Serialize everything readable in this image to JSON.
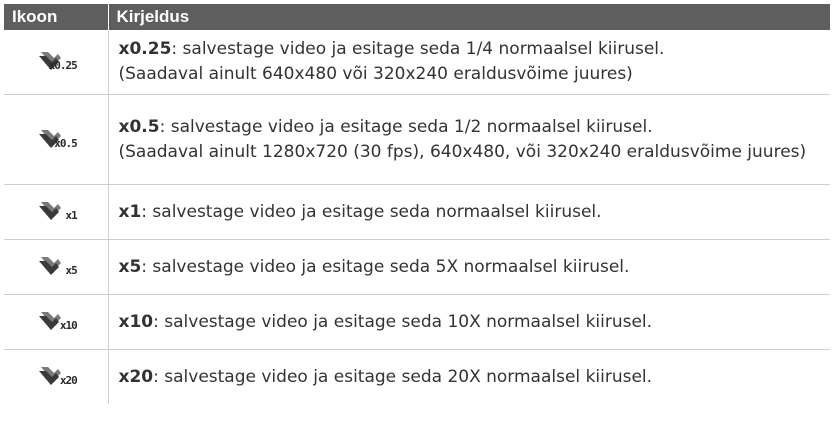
{
  "header": {
    "col_icon": "Ikoon",
    "col_desc": "Kirjeldus"
  },
  "rows": [
    {
      "icon": "slow-motion-x0.25-icon",
      "icon_label": "x0.25",
      "mode": "x0.25",
      "text": ": salvestage video ja esitage seda 1/4 normaalsel kiirusel.",
      "note": "(Saadaval ainult 640x480 või 320x240 eraldusvõime juures)"
    },
    {
      "icon": "slow-motion-x0.5-icon",
      "icon_label": "x0.5",
      "mode": "x0.5",
      "text": ": salvestage video ja esitage seda 1/2 normaalsel kiirusel.",
      "note": "(Saadaval ainult 1280x720 (30 fps), 640x480, või 320x240 eraldusvõime juures)"
    },
    {
      "icon": "speed-x1-icon",
      "icon_label": "x1",
      "mode": "x1",
      "text": ": salvestage video ja esitage seda normaalsel kiirusel."
    },
    {
      "icon": "fast-motion-x5-icon",
      "icon_label": "x5",
      "mode": "x5",
      "text": ": salvestage video ja esitage seda 5X normaalsel kiirusel."
    },
    {
      "icon": "fast-motion-x10-icon",
      "icon_label": "x10",
      "mode": "x10",
      "text": ": salvestage video ja esitage seda 10X normaalsel kiirusel."
    },
    {
      "icon": "fast-motion-x20-icon",
      "icon_label": "x20",
      "mode": "x20",
      "text": ": salvestage video ja esitage seda 20X normaalsel kiirusel."
    }
  ],
  "colors": {
    "header_bg": "#5e5e5e",
    "header_text": "#ffffff",
    "border": "#cfcfcf",
    "text": "#333333"
  }
}
